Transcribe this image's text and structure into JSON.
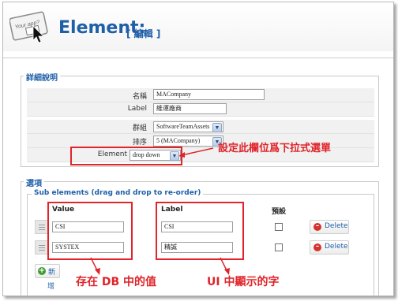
{
  "header": {
    "title": "Element:",
    "subtitle": "[ 編輯 ]",
    "logo_text": "Your app?"
  },
  "details": {
    "legend": "詳細說明",
    "fields": [
      {
        "label": "名稱",
        "value": "MACompany"
      },
      {
        "label": "Label",
        "value": "維運廠商"
      }
    ],
    "group": {
      "label": "群組",
      "value": "SoftwareTeamAssets"
    },
    "order": {
      "label": "排序",
      "value": "5 (MACompany)"
    },
    "element_type": {
      "label": "Element type",
      "value": "drop down"
    }
  },
  "options": {
    "legend": "選項",
    "sub_legend": "Sub elements (drag and drop to re-order)",
    "columns": {
      "value": "Value",
      "label": "Label",
      "default": "預設"
    },
    "rows": [
      {
        "value": "CSI",
        "label": "CSI",
        "delete": "Delete"
      },
      {
        "value": "SYSTEX",
        "label": "精誠",
        "delete": "Delete"
      }
    ],
    "add_label": "新",
    "add_label_2": "增"
  },
  "annotations": {
    "dropdown_note": "設定此欄位爲下拉式選單",
    "db_note": "存在 DB 中的值",
    "ui_note": "UI 中顯示的字"
  },
  "colors": {
    "accent": "#1f5fa8",
    "annotation": "#e0242a"
  }
}
